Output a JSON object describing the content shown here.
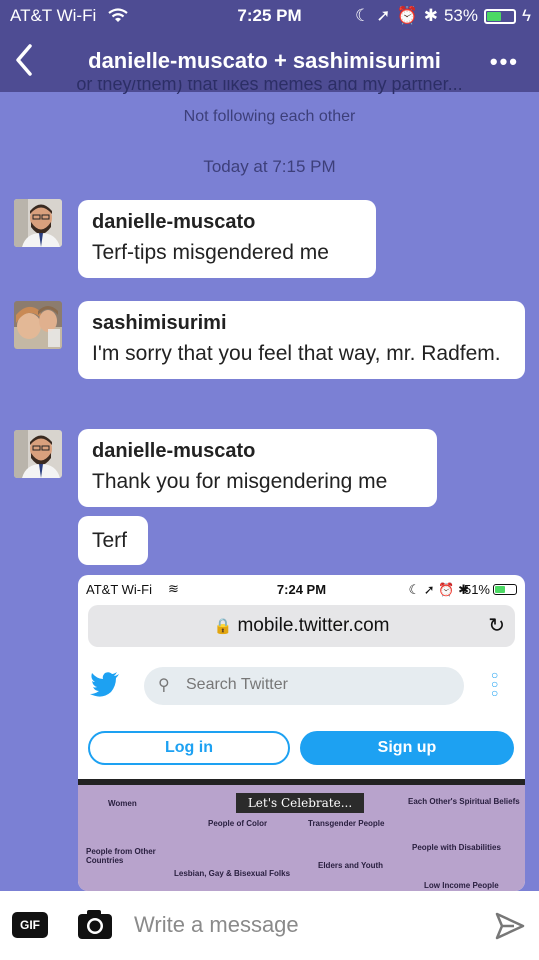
{
  "status": {
    "carrier": "AT&T Wi-Fi",
    "time": "7:25 PM",
    "battery": "53%",
    "battery_level": 0.53
  },
  "header": {
    "title": "danielle-muscato + sashimisurimi"
  },
  "conversation": {
    "bio_cut": "or they/them) that likes memes and my partner...",
    "follow_status": "Not following each other",
    "timestamp": "Today at 7:15 PM"
  },
  "messages": [
    {
      "sender": "danielle-muscato",
      "text": "Terf-tips misgendered me"
    },
    {
      "sender": "sashimisurimi",
      "text": "I'm sorry that you feel that way, mr. Radfem."
    },
    {
      "sender": "danielle-muscato",
      "text": "Thank you for misgendering me"
    },
    {
      "sender": "",
      "text": "Terf"
    }
  ],
  "attachment": {
    "status": {
      "carrier": "AT&T Wi-Fi",
      "time": "7:24 PM",
      "battery": "51%",
      "battery_level": 0.51
    },
    "url": "mobile.twitter.com",
    "search_placeholder": "Search Twitter",
    "login_label": "Log in",
    "signup_label": "Sign up",
    "poster_title": "Let's Celebrate...",
    "poster_items": [
      "Women",
      "People of Color",
      "Transgender People",
      "Each Other's Spiritual Beliefs",
      "People from Other Countries",
      "Lesbian, Gay & Bisexual Folks",
      "Elders and Youth",
      "People with Disabilities",
      "Low Income People"
    ]
  },
  "composer": {
    "gif_label": "GIF",
    "placeholder": "Write a message"
  },
  "colors": {
    "background": "#7b80d4",
    "header": "#4e4c93",
    "twitter_blue": "#1da1f2"
  }
}
